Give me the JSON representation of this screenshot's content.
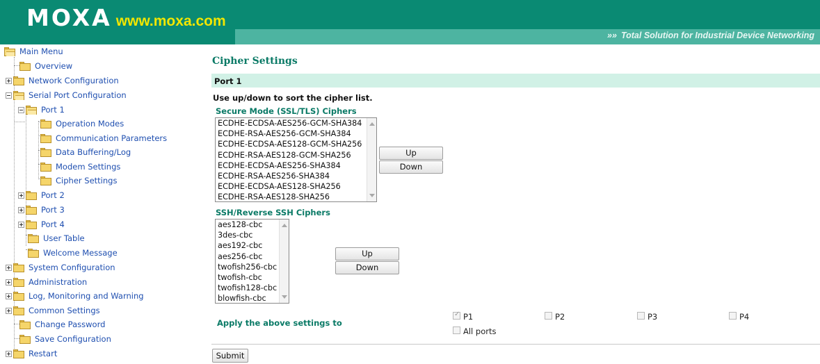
{
  "header": {
    "logo": "MOXA",
    "url": "www.moxa.com",
    "tagline_arrows": "»»",
    "tagline": "Total Solution for Industrial Device Networking"
  },
  "sidebar": {
    "main_menu": "Main Menu",
    "overview": "Overview",
    "network_configuration": "Network Configuration",
    "serial_port_configuration": "Serial Port Configuration",
    "port1": "Port 1",
    "operation_modes": "Operation Modes",
    "communication_parameters": "Communication Parameters",
    "data_buffering_log": "Data Buffering/Log",
    "modem_settings": "Modem Settings",
    "cipher_settings": "Cipher Settings",
    "port2": "Port 2",
    "port3": "Port 3",
    "port4": "Port 4",
    "user_table": "User Table",
    "welcome_message": "Welcome Message",
    "system_configuration": "System Configuration",
    "administration": "Administration",
    "log_monitoring_warning": "Log, Monitoring and Warning",
    "common_settings": "Common Settings",
    "change_password": "Change Password",
    "save_configuration": "Save Configuration",
    "restart": "Restart"
  },
  "main": {
    "title": "Cipher Settings",
    "port_bar": "Port 1",
    "instruction": "Use up/down to sort the cipher list.",
    "ssl": {
      "label": "Secure Mode (SSL/TLS) Ciphers",
      "options": [
        "ECDHE-ECDSA-AES256-GCM-SHA384",
        "ECDHE-RSA-AES256-GCM-SHA384",
        "ECDHE-ECDSA-AES128-GCM-SHA256",
        "ECDHE-RSA-AES128-GCM-SHA256",
        "ECDHE-ECDSA-AES256-SHA384",
        "ECDHE-RSA-AES256-SHA384",
        "ECDHE-ECDSA-AES128-SHA256",
        "ECDHE-RSA-AES128-SHA256"
      ],
      "up": "Up",
      "down": "Down"
    },
    "ssh": {
      "label": "SSH/Reverse SSH Ciphers",
      "options": [
        "aes128-cbc",
        "3des-cbc",
        "aes192-cbc",
        "aes256-cbc",
        "twofish256-cbc",
        "twofish-cbc",
        "twofish128-cbc",
        "blowfish-cbc"
      ],
      "up": "Up",
      "down": "Down"
    },
    "apply": {
      "label": "Apply the above settings to",
      "p1": "P1",
      "p1_checked": true,
      "p2": "P2",
      "p3": "P3",
      "p4": "P4",
      "all_ports": "All ports"
    },
    "submit": "Submit"
  },
  "colors": {
    "header_bg": "#0a8a73",
    "header_accent": "#4db4a1",
    "url_yellow": "#f2e600",
    "section_green": "#0a7a66",
    "port_bar_bg": "#d1f1e6",
    "link_blue": "#1f4fb0"
  }
}
